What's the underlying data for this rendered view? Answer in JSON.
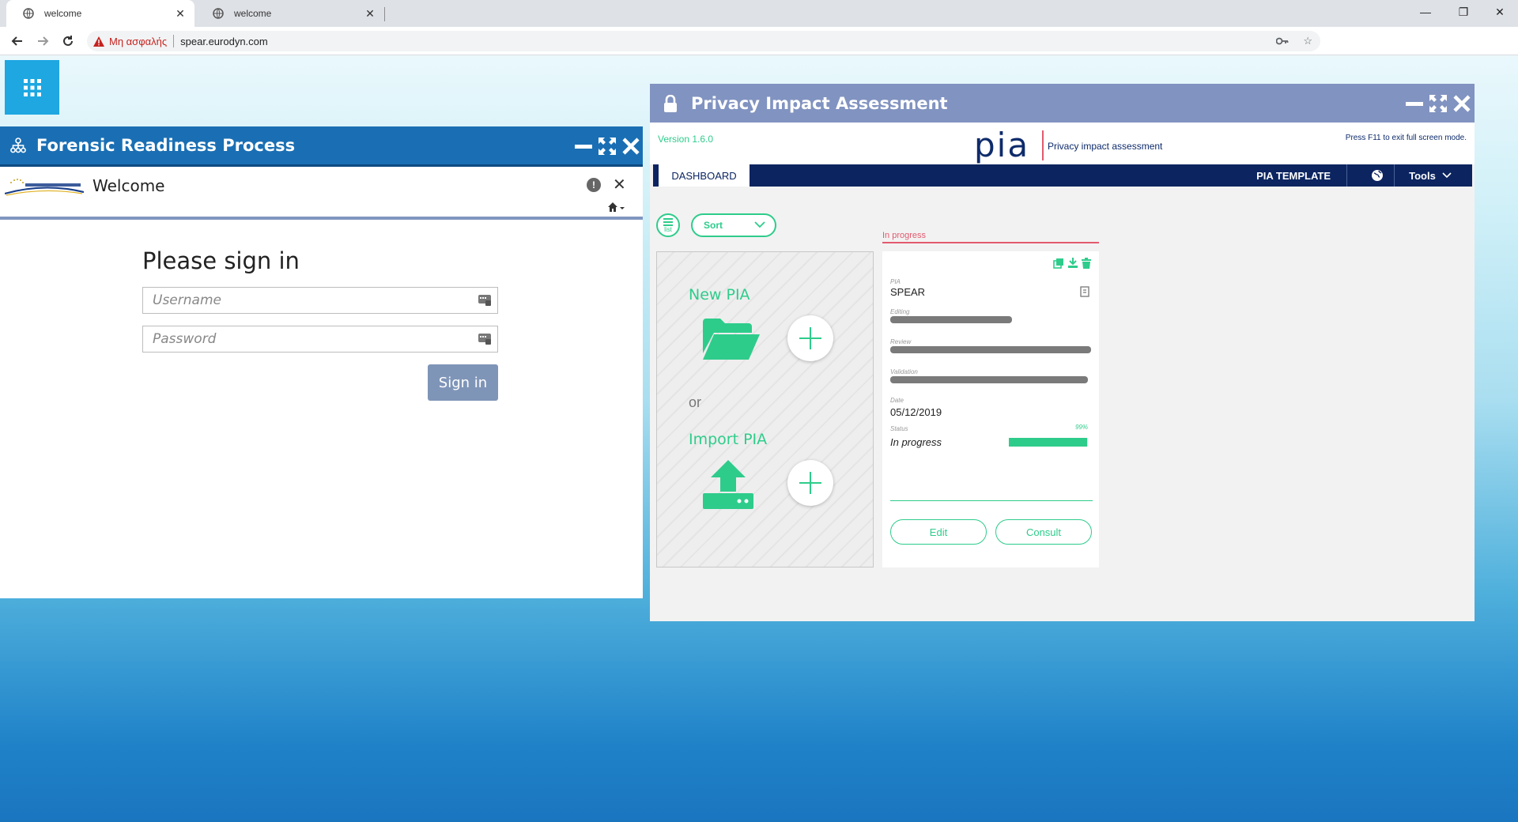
{
  "browser": {
    "tabs": [
      {
        "title": "welcome",
        "active": true
      },
      {
        "title": "welcome",
        "active": false
      }
    ],
    "security_warning": "Μη ασφαλής",
    "url": "spear.eurodyn.com"
  },
  "frp_window": {
    "title": "Forensic Readiness Process",
    "header_title": "Welcome",
    "help_glyph": "!",
    "signin": {
      "heading": "Please sign in",
      "username_placeholder": "Username",
      "password_placeholder": "Password",
      "button_label": "Sign in"
    }
  },
  "pia_window": {
    "title": "Privacy Impact Assessment",
    "version": "Version 1.6.0",
    "logo": "pia",
    "tagline": "Privacy impact assessment",
    "fullscreen_hint": "Press F11 to exit full screen mode.",
    "nav": {
      "dashboard": "DASHBOARD",
      "template": "PIA TEMPLATE",
      "tools": "Tools"
    },
    "controls": {
      "list_label": "list",
      "sort_label": "Sort"
    },
    "create": {
      "new_label": "New PIA",
      "or_label": "or",
      "import_label": "Import PIA"
    },
    "column_header": "In progress",
    "card": {
      "pia_label": "PIA",
      "pia_value": "SPEAR",
      "editing_label": "Editing",
      "review_label": "Review",
      "validation_label": "Validation",
      "date_label": "Date",
      "date_value": "05/12/2019",
      "status_label": "Status",
      "status_value": "In progress",
      "progress_pct": "99%",
      "progress_fraction": 0.99,
      "edit_label": "Edit",
      "consult_label": "Consult"
    }
  },
  "colors": {
    "frp_titlebar": "#1a6fb4",
    "pia_titlebar": "#8193c0",
    "pia_navy": "#0c2560",
    "pia_green": "#2ecc8b",
    "pia_red": "#e25a6e",
    "signin_button": "#7f95b8"
  },
  "icons": {
    "tab": "globe-icon",
    "frp_title": "sitemap-icon",
    "pia_title": "lock-icon",
    "launcher": "grid-icon",
    "window_controls": [
      "minimize-icon",
      "expand-icon",
      "close-icon"
    ]
  }
}
